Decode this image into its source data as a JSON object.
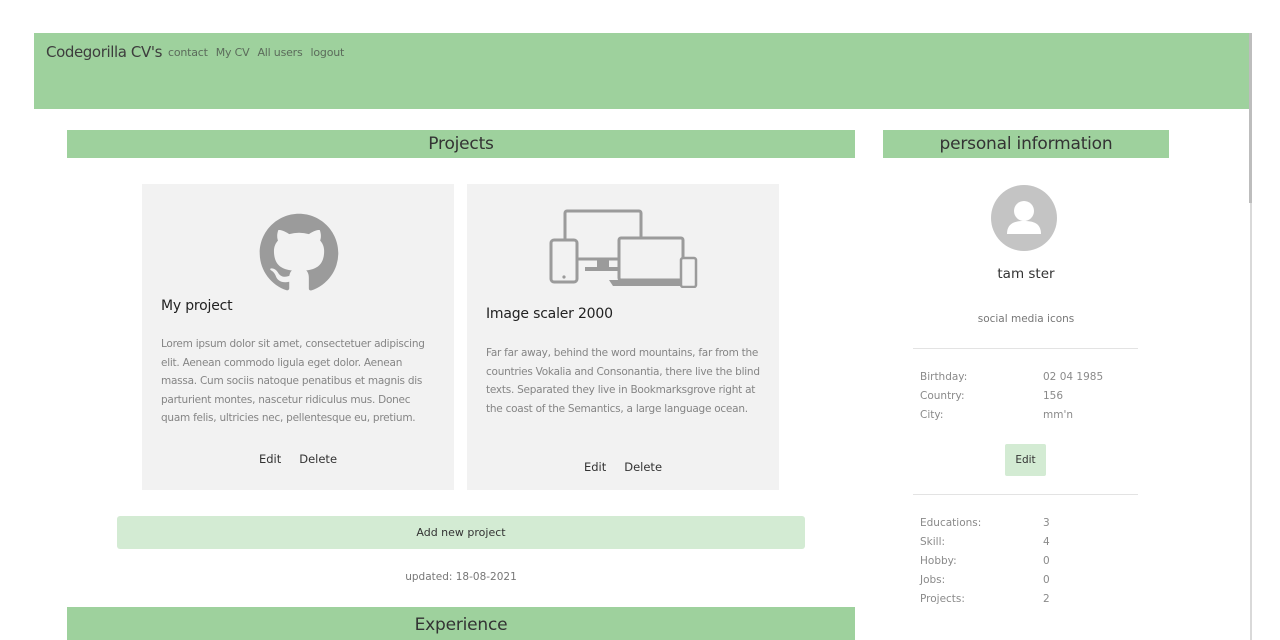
{
  "navbar": {
    "brand": "Codegorilla CV's",
    "links": [
      "contact",
      "My CV",
      "All users",
      "logout"
    ]
  },
  "projects": {
    "header": "Projects",
    "cards": [
      {
        "icon": "github-icon",
        "title": "My project",
        "description": "Lorem ipsum dolor sit amet, consectetuer adipiscing elit. Aenean commodo ligula eget dolor. Aenean massa. Cum sociis natoque penatibus et magnis dis parturient montes, nascetur ridiculus mus. Donec quam felis, ultricies nec, pellentesque eu, pretium.",
        "edit_label": "Edit",
        "delete_label": "Delete"
      },
      {
        "icon": "devices-icon",
        "title": "Image scaler 2000",
        "description": "Far far away, behind the word mountains, far from the countries Vokalia and Consonantia, there live the blind texts. Separated they live in Bookmarksgrove right at the coast of the Semantics, a large language ocean.",
        "edit_label": "Edit",
        "delete_label": "Delete"
      }
    ],
    "add_button": "Add new project",
    "updated": "updated: 18-08-2021"
  },
  "next_section": {
    "header": "Experience"
  },
  "personal": {
    "header": "personal information",
    "name": "tam ster",
    "social": "social media icons",
    "details": [
      {
        "label": "Birthday:",
        "value": "02 04 1985"
      },
      {
        "label": "Country:",
        "value": "156"
      },
      {
        "label": "City:",
        "value": "mm'n"
      }
    ],
    "edit_button": "Edit",
    "stats": [
      {
        "label": "Educations:",
        "value": "3"
      },
      {
        "label": "Skill:",
        "value": "4"
      },
      {
        "label": "Hobby:",
        "value": "0"
      },
      {
        "label": "Jobs:",
        "value": "0"
      },
      {
        "label": "Projects:",
        "value": "2"
      }
    ]
  },
  "colors": {
    "navbar": "#9ed19d",
    "card": "#f2f2f2",
    "button": "#d3ebd3",
    "avatar": "#c4c4c4"
  }
}
